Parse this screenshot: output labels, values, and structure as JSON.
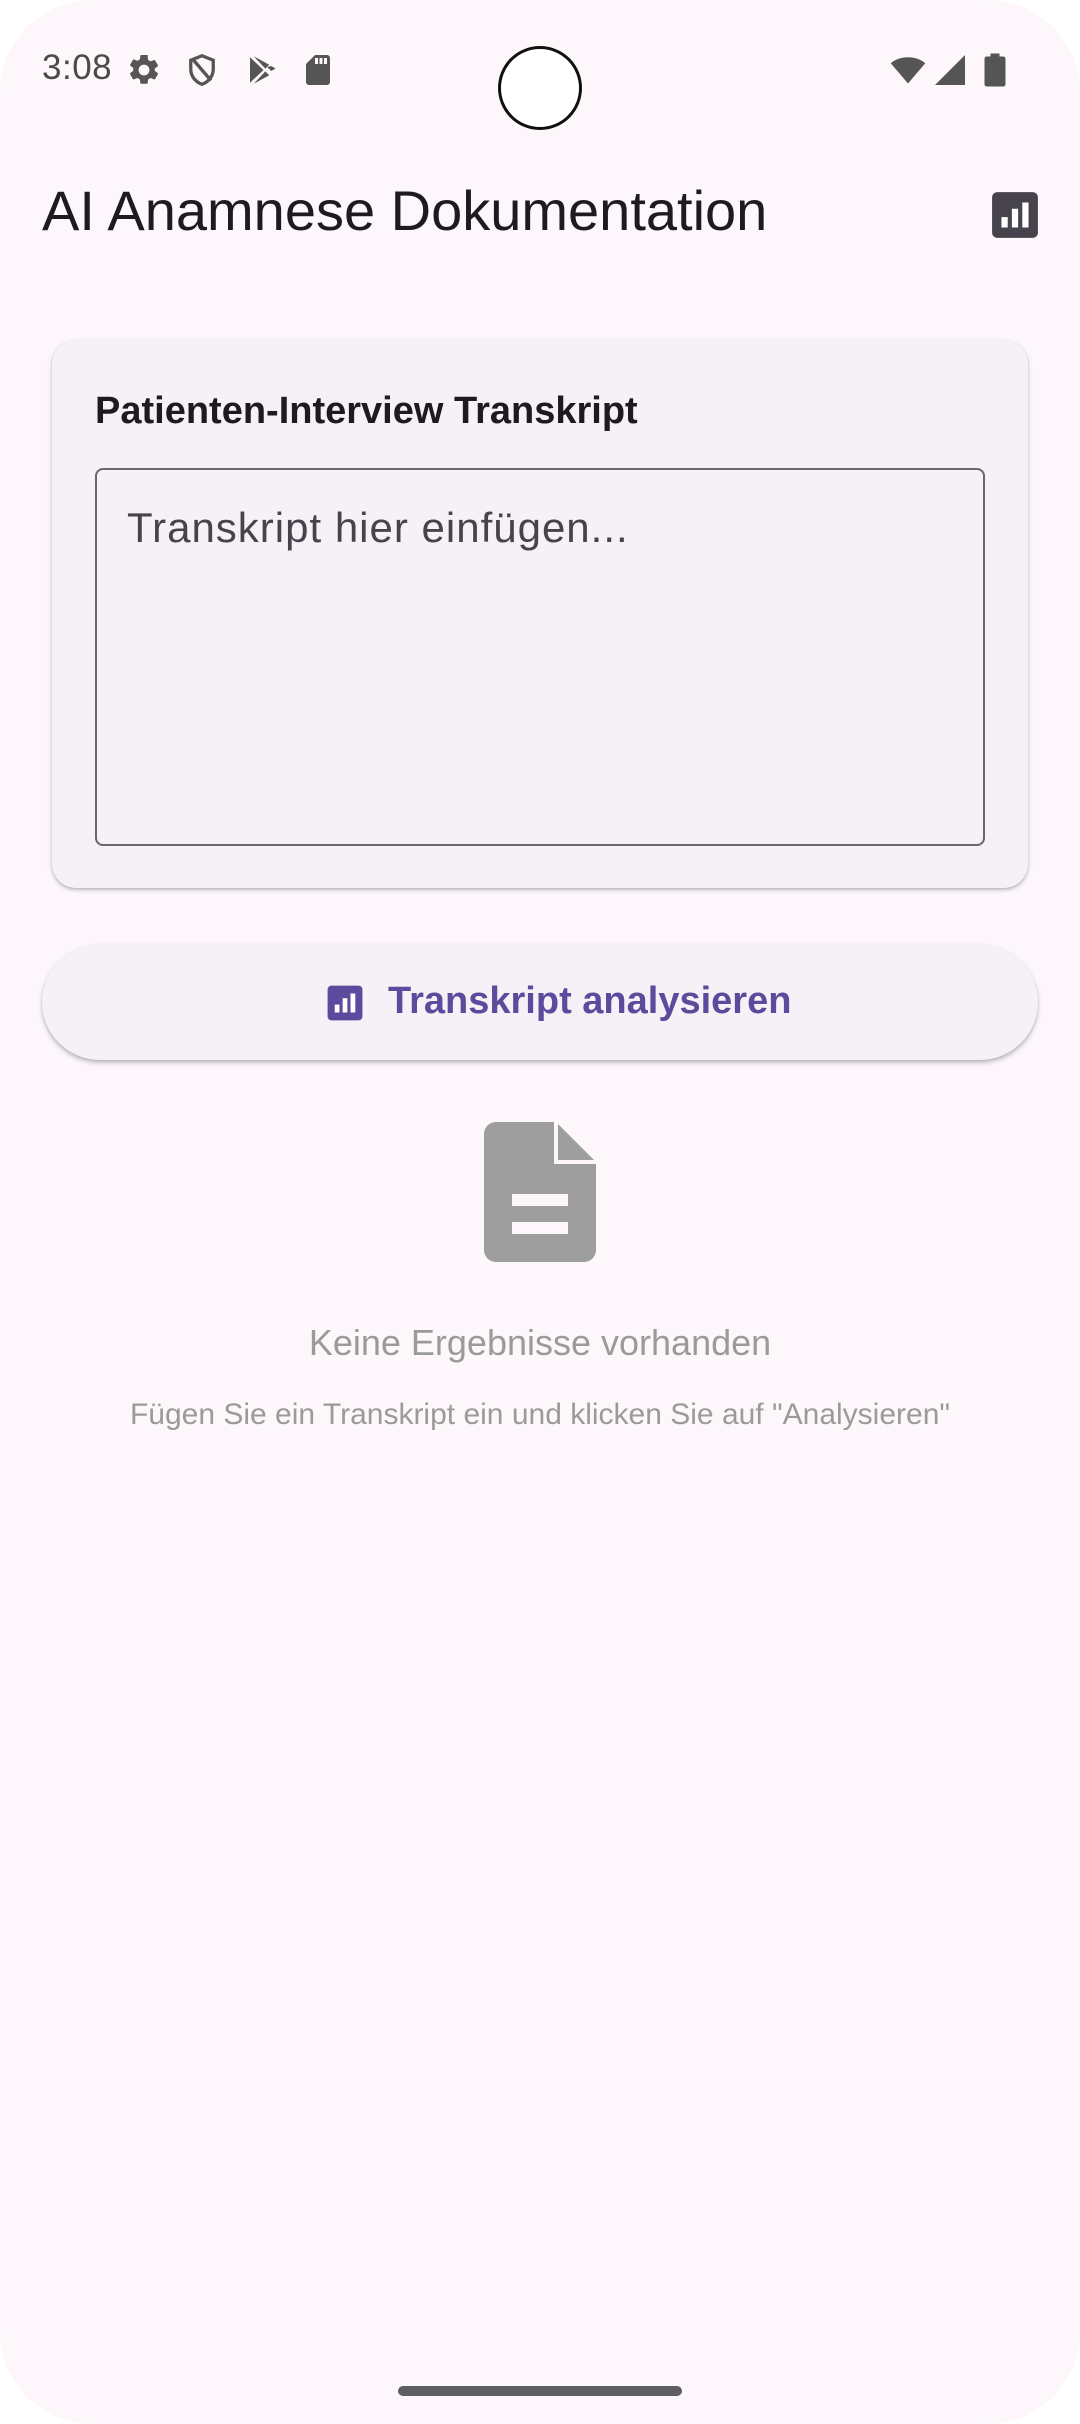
{
  "status_bar": {
    "time": "3:08",
    "left_icons": [
      "settings-icon",
      "shield-icon",
      "play-store-icon",
      "sd-card-icon"
    ],
    "right_icons": [
      "wifi-icon",
      "signal-icon",
      "battery-icon"
    ]
  },
  "app_bar": {
    "title": "AI Anamnese Dokumentation",
    "action_icon": "analytics-icon"
  },
  "transcript_card": {
    "title": "Patienten-Interview Transkript",
    "input": {
      "value": "",
      "placeholder": "Transkript hier einfügen..."
    }
  },
  "analyze_button": {
    "label": "Transkript analysieren",
    "icon": "analytics-icon"
  },
  "empty_state": {
    "icon": "document-icon",
    "title": "Keine Ergebnisse vorhanden",
    "subtitle": "Fügen Sie ein Transkript ein und klicken Sie auf \"Analysieren\""
  },
  "colors": {
    "background": "#fdf7fc",
    "surface": "#f5f1f6",
    "primary": "#5e4a9c",
    "on_surface": "#1d1b20",
    "muted": "#9a9a9a"
  }
}
